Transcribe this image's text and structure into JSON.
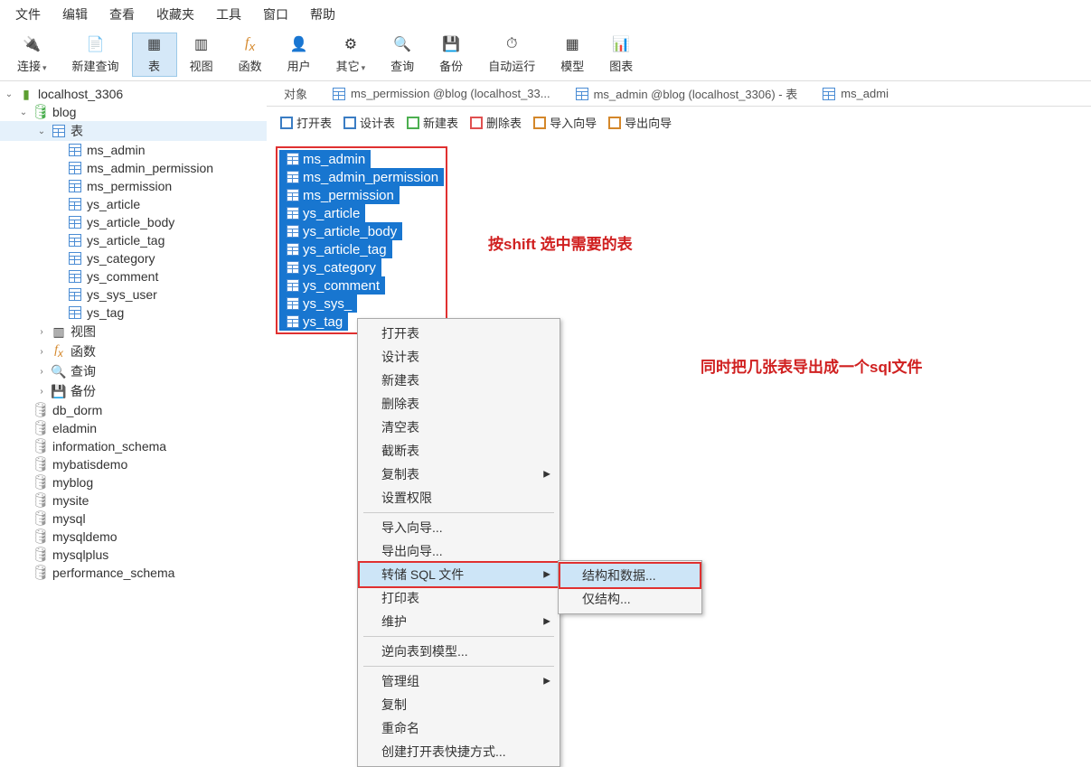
{
  "menubar": [
    "文件",
    "编辑",
    "查看",
    "收藏夹",
    "工具",
    "窗口",
    "帮助"
  ],
  "toolbar": [
    {
      "label": "连接",
      "icon": "🔌",
      "dd": true
    },
    {
      "label": "新建查询",
      "icon": "📄"
    },
    {
      "label": "表",
      "icon": "▦",
      "active": true
    },
    {
      "label": "视图",
      "icon": "▥"
    },
    {
      "label": "函数",
      "icon": "fx",
      "fx": true
    },
    {
      "label": "用户",
      "icon": "👤"
    },
    {
      "label": "其它",
      "icon": "⚙",
      "dd": true
    },
    {
      "label": "查询",
      "icon": "🔍"
    },
    {
      "label": "备份",
      "icon": "💾"
    },
    {
      "label": "自动运行",
      "icon": "⏱"
    },
    {
      "label": "模型",
      "icon": "▦"
    },
    {
      "label": "图表",
      "icon": "📊"
    }
  ],
  "connection": "localhost_3306",
  "active_db": "blog",
  "tables_node": "表",
  "tables": [
    "ms_admin",
    "ms_admin_permission",
    "ms_permission",
    "ys_article",
    "ys_article_body",
    "ys_article_tag",
    "ys_category",
    "ys_comment",
    "ys_sys_user",
    "ys_tag"
  ],
  "other_nodes": [
    {
      "label": "视图",
      "icon": "view"
    },
    {
      "label": "函数",
      "icon": "fx"
    },
    {
      "label": "查询",
      "icon": "query"
    },
    {
      "label": "备份",
      "icon": "backup"
    }
  ],
  "other_dbs": [
    "db_dorm",
    "eladmin",
    "information_schema",
    "mybatisdemo",
    "myblog",
    "mysite",
    "mysql",
    "mysqldemo",
    "mysqlplus",
    "performance_schema"
  ],
  "tabs": [
    {
      "label": "对象",
      "plain": true
    },
    {
      "label": "ms_permission @blog (localhost_33..."
    },
    {
      "label": "ms_admin @blog (localhost_3306) - 表"
    },
    {
      "label": "ms_admi"
    }
  ],
  "actions": [
    "打开表",
    "设计表",
    "新建表",
    "删除表",
    "导入向导",
    "导出向导"
  ],
  "selected_tables": [
    "ms_admin",
    "ms_admin_permission",
    "ms_permission",
    "ys_article",
    "ys_article_body",
    "ys_article_tag",
    "ys_category",
    "ys_comment",
    "ys_sys_",
    "ys_tag"
  ],
  "annotations": {
    "a1": "按shift 选中需要的表",
    "a2": "同时把几张表导出成一个sql文件"
  },
  "ctx_menu": {
    "g1": [
      "打开表",
      "设计表",
      "新建表",
      "删除表",
      "清空表",
      "截断表"
    ],
    "g1b": [
      {
        "label": "复制表",
        "arrow": true
      },
      {
        "label": "设置权限"
      }
    ],
    "g2": [
      "导入向导...",
      "导出向导..."
    ],
    "dump": "转储 SQL 文件",
    "g3": [
      "打印表"
    ],
    "g3b": [
      {
        "label": "维护",
        "arrow": true
      }
    ],
    "g4": [
      "逆向表到模型..."
    ],
    "g5": [
      {
        "label": "管理组",
        "arrow": true
      },
      {
        "label": "复制"
      },
      {
        "label": "重命名"
      },
      {
        "label": "创建打开表快捷方式..."
      }
    ],
    "sub": [
      "结构和数据...",
      "仅结构..."
    ]
  }
}
